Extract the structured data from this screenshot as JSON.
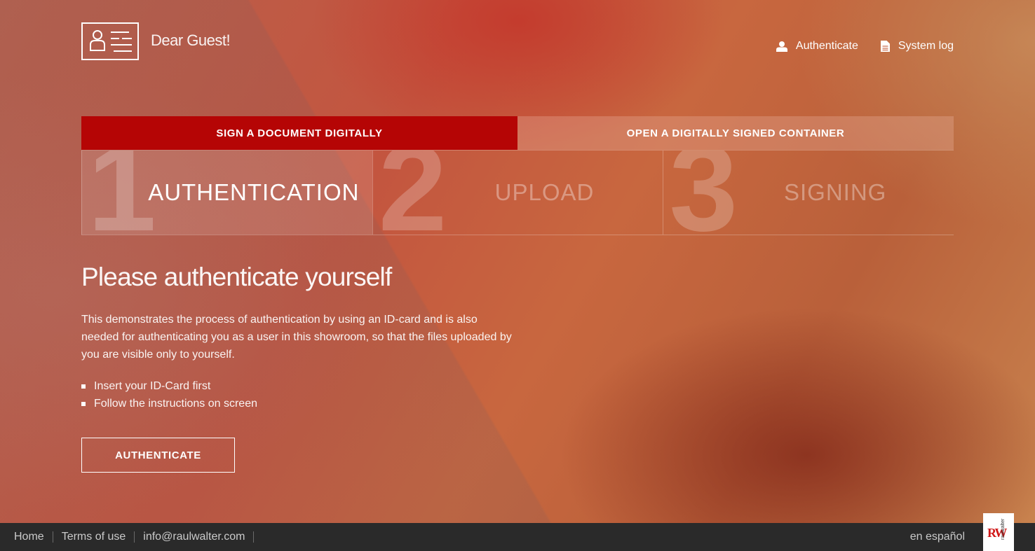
{
  "header": {
    "greeting": "Dear Guest!",
    "nav": [
      {
        "label": "Authenticate",
        "icon": "user-icon"
      },
      {
        "label": "System log",
        "icon": "document-icon"
      }
    ]
  },
  "tabs": [
    {
      "label": "SIGN A DOCUMENT DIGITALLY",
      "active": true
    },
    {
      "label": "OPEN A DIGITALLY SIGNED CONTAINER",
      "active": false
    }
  ],
  "steps": [
    {
      "number": "1",
      "label": "AUTHENTICATION",
      "state": "active"
    },
    {
      "number": "2",
      "label": "UPLOAD",
      "state": "pending"
    },
    {
      "number": "3",
      "label": "SIGNING",
      "state": "pending"
    }
  ],
  "main": {
    "title": "Please authenticate yourself",
    "description": "This demonstrates the process of authentication by using an ID-card and is also needed for authenticating you as a user in this showroom, so that the files uploaded by you are visible only to yourself.",
    "bullets": [
      "Insert your ID-Card first",
      "Follow the instructions on screen"
    ],
    "button_label": "AUTHENTICATE"
  },
  "footer": {
    "links": [
      "Home",
      "Terms of use",
      "info@raulwalter.com"
    ],
    "language": "en español",
    "brand_text": "raulwalter"
  },
  "colors": {
    "accent": "#b50505",
    "footer_bg": "#2a2a2a"
  }
}
